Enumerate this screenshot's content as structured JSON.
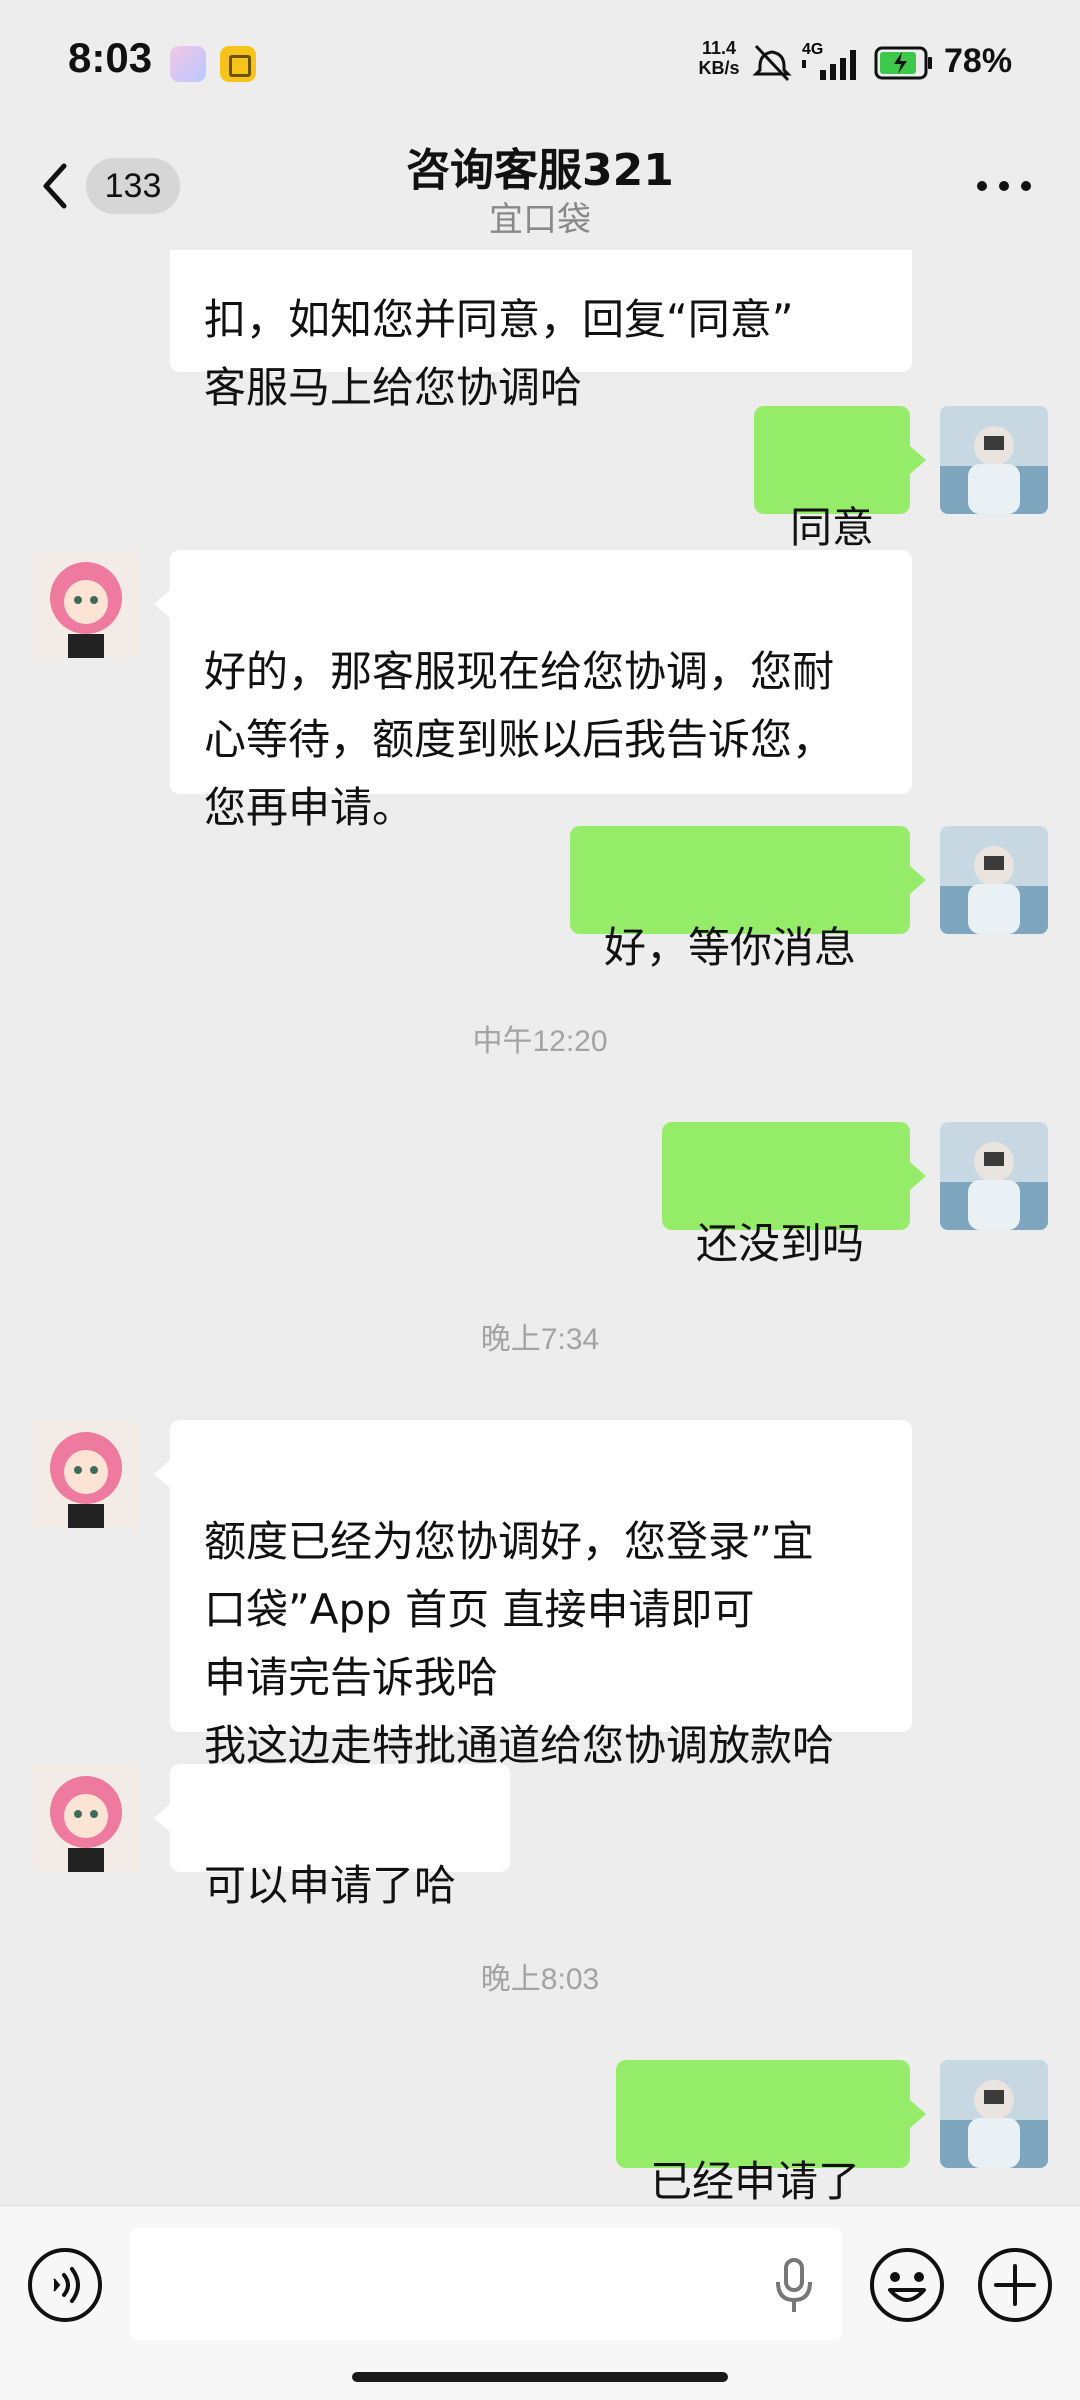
{
  "status_bar": {
    "time": "8:03",
    "net_speed_value": "11.4",
    "net_speed_unit": "KB/s",
    "network": "4G",
    "battery": "78%"
  },
  "header": {
    "back_label": "133",
    "title": "咨询客服321",
    "subtitle": "宜口袋"
  },
  "messages": [
    {
      "side": "left",
      "text": "扣，如知您并同意，回复“同意”\n客服马上给您协调哈",
      "truncated_top": true
    },
    {
      "side": "right",
      "text": "同意"
    },
    {
      "side": "left",
      "text": "好的，那客服现在给您协调，您耐\n心等待，额度到账以后我告诉您，\n您再申请。"
    },
    {
      "side": "right",
      "text": "好，等你消息"
    },
    {
      "type": "time",
      "text": "中午12:20"
    },
    {
      "side": "right",
      "text": "还没到吗"
    },
    {
      "type": "time",
      "text": "晚上7:34"
    },
    {
      "side": "left",
      "text": "额度已经为您协调好，您登录”宜\n口袋”App 首页  直接申请即可\n申请完告诉我哈\n我这边走特批通道给您协调放款哈"
    },
    {
      "side": "left",
      "text": "可以申请了哈"
    },
    {
      "type": "time",
      "text": "晚上8:03"
    },
    {
      "side": "right",
      "text": "已经申请了"
    }
  ],
  "input": {
    "value": "",
    "placeholder": ""
  },
  "icons": {
    "back": "chevron-left-icon",
    "more": "more-dots-icon",
    "voice": "voice-icon",
    "mic": "mic-icon",
    "emoji": "emoji-icon",
    "plus": "plus-icon"
  },
  "colors": {
    "background": "#ededed",
    "sent_bubble": "#95ec69",
    "received_bubble": "#ffffff",
    "timestamp": "#a3a3a3"
  }
}
